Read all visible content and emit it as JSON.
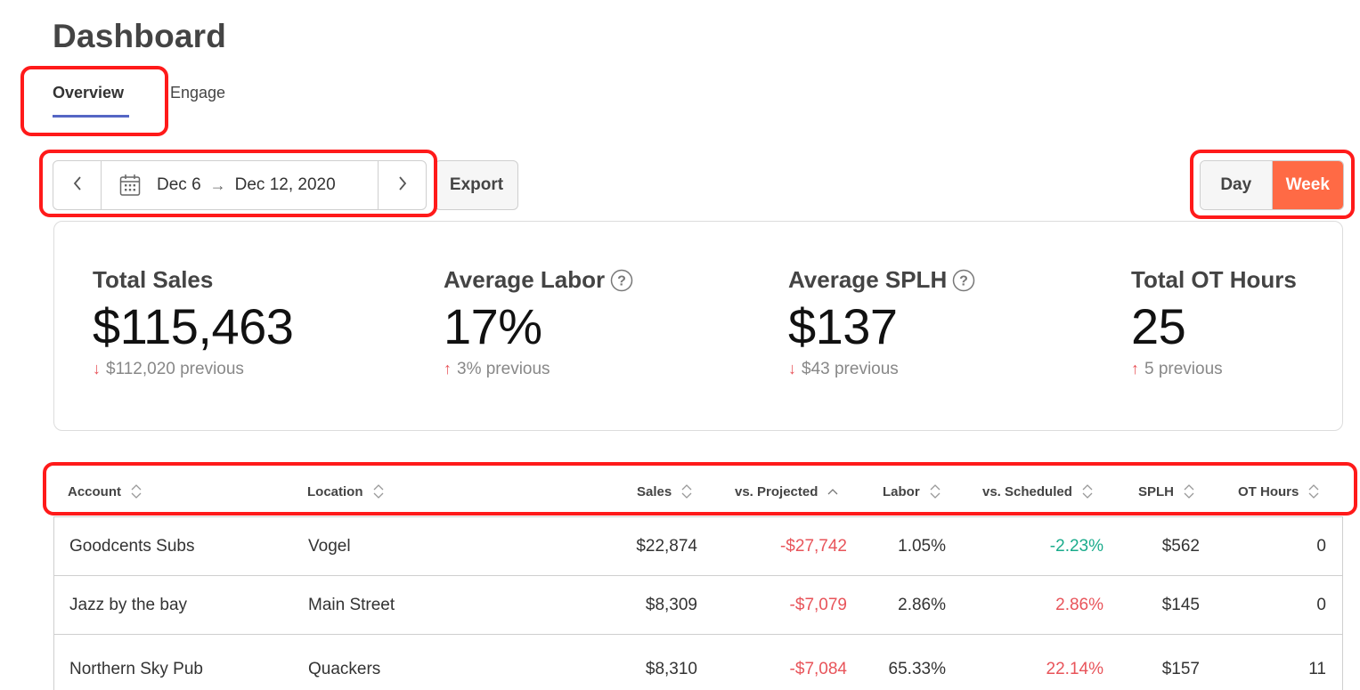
{
  "page": {
    "title": "Dashboard"
  },
  "tabs": [
    {
      "label": "Overview",
      "active": true
    },
    {
      "label": "Engage",
      "active": false
    }
  ],
  "date_range": {
    "start": "Dec 6",
    "end": "Dec 12, 2020"
  },
  "export_label": "Export",
  "period_toggle": {
    "day": "Day",
    "week": "Week",
    "selected": "Week"
  },
  "colors": {
    "accent": "#ff6a45",
    "tab_underline": "#5566c4",
    "negative": "#e8545a",
    "positive": "#1aab8b",
    "highlight_box": "#ff1a1a"
  },
  "stats": [
    {
      "label": "Total Sales",
      "value": "$115,463",
      "direction": "down",
      "previous": "$112,020 previous",
      "help": false
    },
    {
      "label": "Average Labor",
      "value": "17%",
      "direction": "up",
      "previous": "3% previous",
      "help": true
    },
    {
      "label": "Average SPLH",
      "value": "$137",
      "direction": "down",
      "previous": "$43 previous",
      "help": true
    },
    {
      "label": "Total OT Hours",
      "value": "25",
      "direction": "up",
      "previous": "5 previous",
      "help": false
    }
  ],
  "table": {
    "columns": [
      {
        "label": "Account",
        "sort": "none"
      },
      {
        "label": "Location",
        "sort": "none"
      },
      {
        "label": "Sales",
        "sort": "none"
      },
      {
        "label": "vs. Projected",
        "sort": "asc"
      },
      {
        "label": "Labor",
        "sort": "none"
      },
      {
        "label": "vs. Scheduled",
        "sort": "none"
      },
      {
        "label": "SPLH",
        "sort": "none"
      },
      {
        "label": "OT Hours",
        "sort": "none"
      }
    ],
    "rows": [
      {
        "account": "Goodcents Subs",
        "location": "Vogel",
        "sales": "$22,874",
        "vs_projected": "-$27,742",
        "labor": "1.05%",
        "vs_scheduled": "-2.23%",
        "splh": "$562",
        "ot_hours": "0"
      },
      {
        "account": "Jazz by the bay",
        "location": "Main Street",
        "sales": "$8,309",
        "vs_projected": "-$7,079",
        "labor": "2.86%",
        "vs_scheduled": "2.86%",
        "splh": "$145",
        "ot_hours": "0"
      },
      {
        "account": "Northern Sky Pub",
        "location": "Quackers",
        "sales": "$8,310",
        "vs_projected": "-$7,084",
        "labor": "65.33%",
        "vs_scheduled": "22.14%",
        "splh": "$157",
        "ot_hours": "11"
      }
    ]
  }
}
